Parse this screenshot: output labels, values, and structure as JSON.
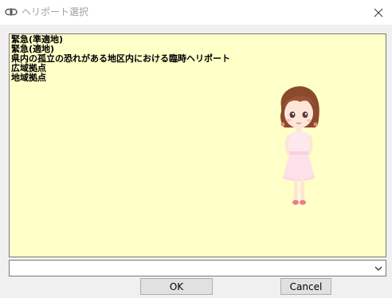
{
  "window": {
    "title": "ヘリポート選択",
    "close_icon": "close-icon",
    "app_icon": "app-icon"
  },
  "list": {
    "items": [
      "緊急(準適地)",
      "緊急(適地)",
      "県内の孤立の恐れがある地区内における臨時ヘリポート",
      "広域拠点",
      "地域拠点"
    ],
    "background_color": "#ffffc8",
    "mascot": "girl-character-illustration"
  },
  "combo": {
    "value": "",
    "dropdown_icon": "chevron-down-icon"
  },
  "buttons": {
    "ok_label": "OK",
    "cancel_label": "Cancel"
  }
}
